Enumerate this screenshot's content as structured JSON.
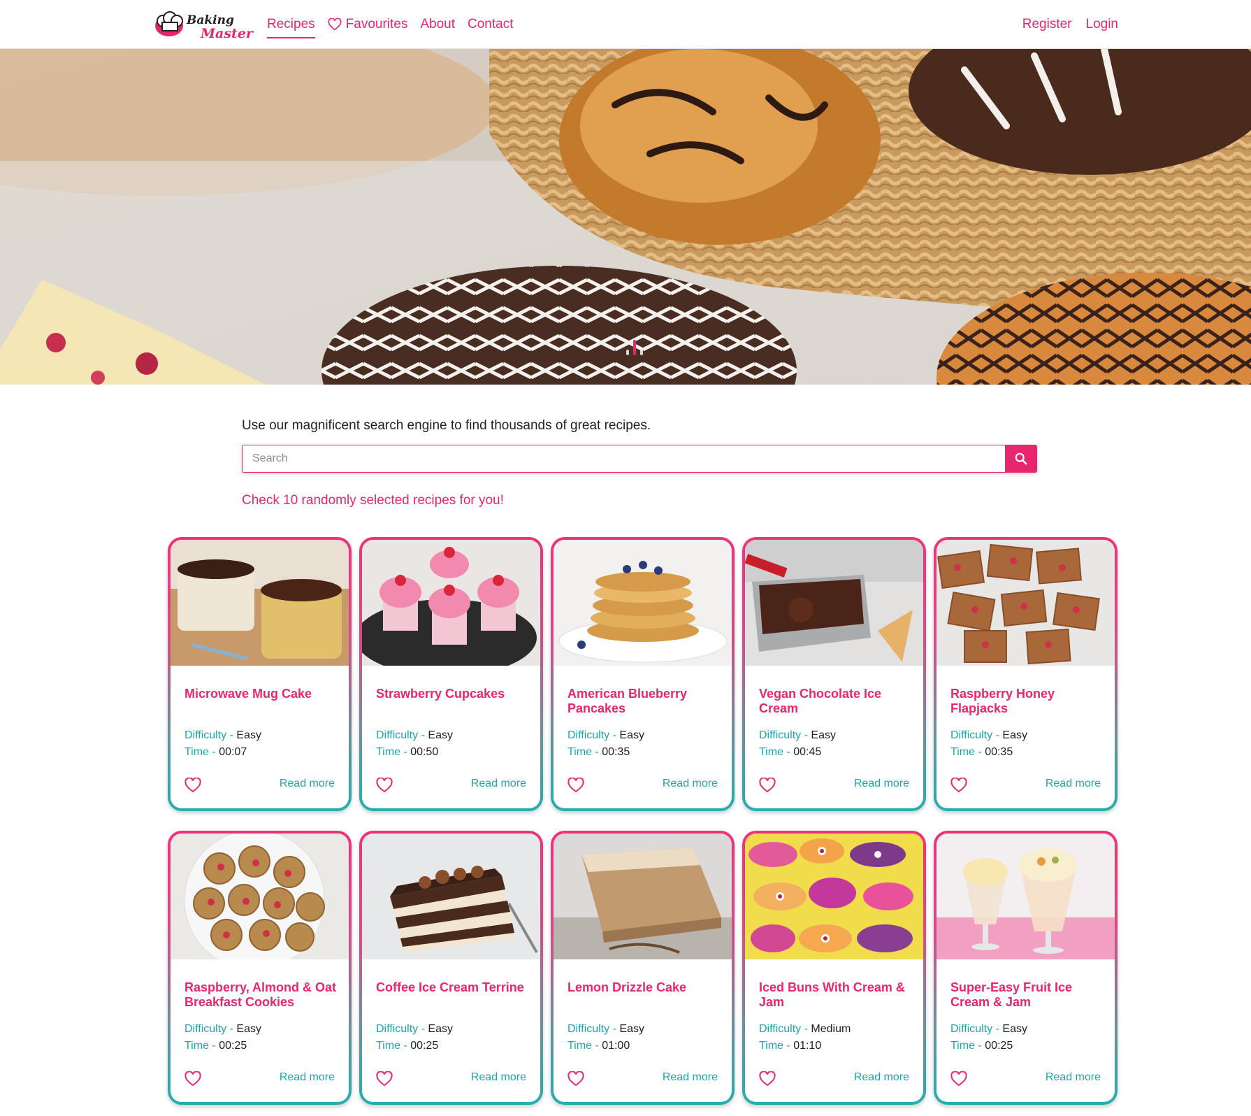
{
  "brand": {
    "logo_line1": "Baking",
    "logo_line2": "Master",
    "pink": "#e8256f",
    "teal": "#1aa7ab"
  },
  "nav": {
    "links": [
      {
        "label": "Recipes",
        "active": true
      },
      {
        "label": "Favourites",
        "icon": "heart-outline-icon"
      },
      {
        "label": "About"
      },
      {
        "label": "Contact"
      }
    ],
    "right": [
      {
        "label": "Register"
      },
      {
        "label": "Login"
      }
    ]
  },
  "hero": {
    "slides": 3,
    "active_slide": 2
  },
  "search": {
    "intro": "Use our magnificent search engine to find thousands of great recipes.",
    "placeholder": "Search",
    "value": "",
    "button_icon": "search-icon"
  },
  "random_note": "Check 10 randomly selected recipes for you!",
  "card_labels": {
    "difficulty": "Difficulty",
    "time": "Time",
    "separator": " - ",
    "read_more": "Read more"
  },
  "recipes": [
    {
      "title": "Microwave Mug Cake",
      "difficulty": "Easy",
      "time": "00:07",
      "favourite": false
    },
    {
      "title": "Strawberry Cupcakes",
      "difficulty": "Easy",
      "time": "00:50",
      "favourite": false
    },
    {
      "title": "American Blueberry Pancakes",
      "difficulty": "Easy",
      "time": "00:35",
      "favourite": false
    },
    {
      "title": "Vegan Chocolate Ice Cream",
      "difficulty": "Easy",
      "time": "00:45",
      "favourite": false
    },
    {
      "title": "Raspberry Honey Flapjacks",
      "difficulty": "Easy",
      "time": "00:35",
      "favourite": false
    },
    {
      "title": "Raspberry, Almond & Oat Breakfast Cookies",
      "difficulty": "Easy",
      "time": "00:25",
      "favourite": false
    },
    {
      "title": "Coffee Ice Cream Terrine",
      "difficulty": "Easy",
      "time": "00:25",
      "favourite": false
    },
    {
      "title": "Lemon Drizzle Cake",
      "difficulty": "Easy",
      "time": "01:00",
      "favourite": false
    },
    {
      "title": "Iced Buns With Cream & Jam",
      "difficulty": "Medium",
      "time": "01:10",
      "favourite": false
    },
    {
      "title": "Super-Easy Fruit Ice Cream & Jam",
      "difficulty": "Easy",
      "time": "00:25",
      "favourite": false
    }
  ]
}
